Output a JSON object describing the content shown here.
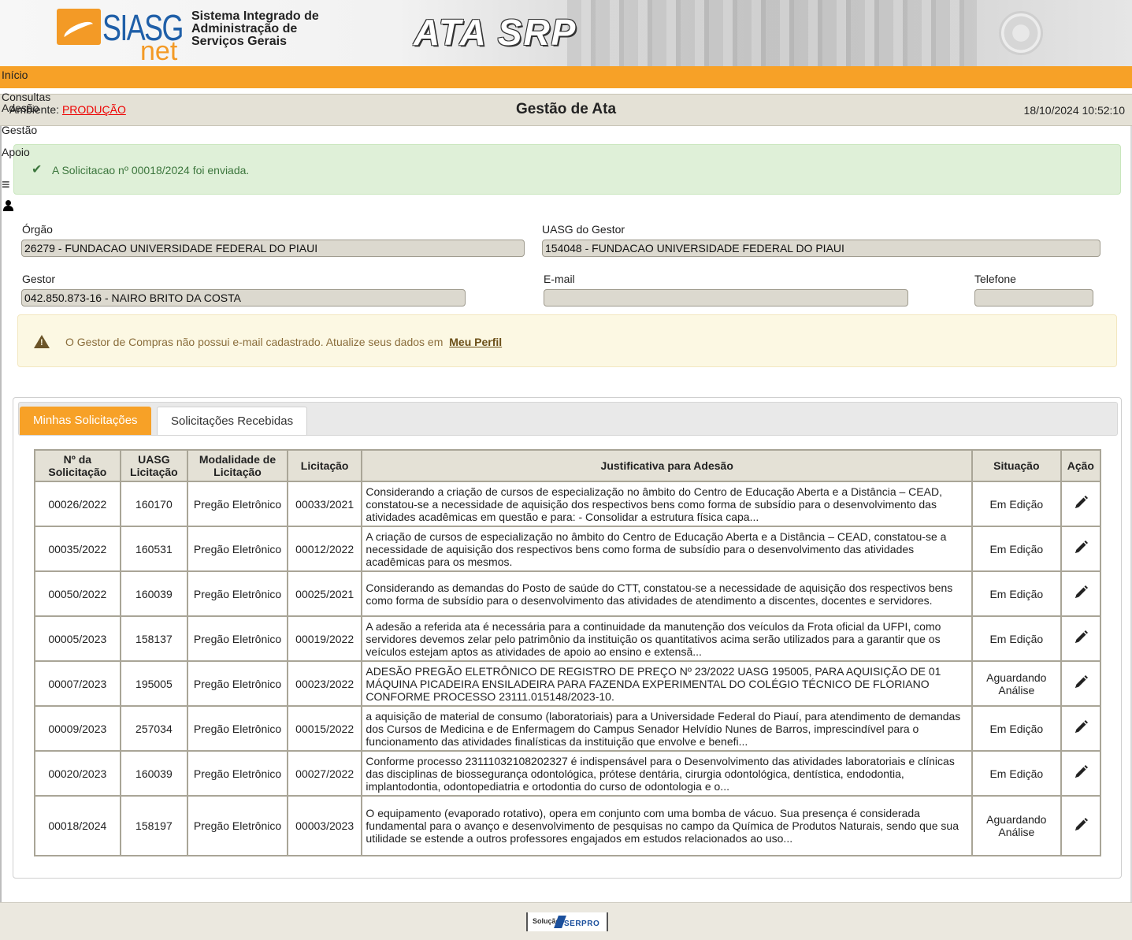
{
  "header": {
    "logo_siasg": "SIASG",
    "logo_net": "net",
    "system_name": "Sistema Integrado de Administração de Serviços Gerais",
    "app_title": "ATA SRP"
  },
  "nav": [
    "Início",
    "Consultas",
    "Adesão",
    "Gestão",
    "Apoio"
  ],
  "titlebar": {
    "ambiente_label": "Ambiente:",
    "ambiente_value": "PRODUÇÃO",
    "page_title": "Gestão de Ata",
    "datetime": "18/10/2024 10:52:10"
  },
  "success_alert": "A Solicitacao nº 00018/2024 foi enviada.",
  "form": {
    "orgao_label": "Órgão",
    "orgao_value": "26279 - FUNDACAO UNIVERSIDADE FEDERAL DO PIAUI",
    "uasg_gestor_label": "UASG do Gestor",
    "uasg_gestor_value": "154048 - FUNDACAO UNIVERSIDADE FEDERAL DO PIAUI",
    "gestor_label": "Gestor",
    "gestor_value": "042.850.873-16 - NAIRO BRITO DA COSTA",
    "email_label": "E-mail",
    "email_value": "",
    "telefone_label": "Telefone",
    "telefone_value": ""
  },
  "warning": {
    "text": "O Gestor de Compras não possui e-mail cadastrado. Atualize seus dados em",
    "link": "Meu Perfil"
  },
  "tabs": [
    "Minhas Solicitações",
    "Solicitações Recebidas"
  ],
  "table": {
    "headers": [
      "Nº da Solicitação",
      "UASG Licitação",
      "Modalidade de Licitação",
      "Licitação",
      "Justificativa para Adesão",
      "Situação",
      "Ação"
    ],
    "rows": [
      [
        "00026/2022",
        "160170",
        "Pregão Eletrônico",
        "00033/2021",
        "Considerando a criação de cursos de especialização no âmbito do Centro de Educação Aberta e a Distância – CEAD, constatou-se a necessidade de aquisição dos respectivos bens como forma de subsídio para o desenvolvimento das atividades acadêmicas em questão e para: - Consolidar a estrutura física capa...",
        "Em Edição"
      ],
      [
        "00035/2022",
        "160531",
        "Pregão Eletrônico",
        "00012/2022",
        "A criação de cursos de especialização no âmbito do Centro de Educação Aberta e a Distância – CEAD, constatou-se a necessidade de aquisição dos respectivos bens como forma de subsídio para o desenvolvimento das atividades acadêmicas para os mesmos.",
        "Em Edição"
      ],
      [
        "00050/2022",
        "160039",
        "Pregão Eletrônico",
        "00025/2021",
        "Considerando as demandas do Posto de saúde do CTT, constatou-se a necessidade de aquisição dos respectivos bens como forma de subsídio para o desenvolvimento das atividades de atendimento a discentes, docentes e servidores.",
        "Em Edição"
      ],
      [
        "00005/2023",
        "158137",
        "Pregão Eletrônico",
        "00019/2022",
        "A adesão a referida ata é necessária para a continuidade da manutenção dos veículos da Frota oficial da UFPI, como servidores devemos zelar pelo patrimônio da instituição os quantitativos acima serão utilizados para a garantir que os veículos estejam aptos as atividades de apoio ao ensino e extensã...",
        "Em Edição"
      ],
      [
        "00007/2023",
        "195005",
        "Pregão Eletrônico",
        "00023/2022",
        "ADESÃO PREGÃO ELETRÔNICO DE REGISTRO DE PREÇO Nº 23/2022 UASG 195005, PARA AQUISIÇÃO DE 01 MÁQUINA PICADEIRA ENSILADEIRA PARA FAZENDA EXPERIMENTAL DO COLÉGIO TÉCNICO DE FLORIANO CONFORME PROCESSO 23111.015148/2023-10.",
        "Aguardando Análise"
      ],
      [
        "00009/2023",
        "257034",
        "Pregão Eletrônico",
        "00015/2022",
        "a aquisição de material de consumo (laboratoriais) para a Universidade Federal do Piauí, para atendimento de demandas dos Cursos de Medicina e de Enfermagem do Campus Senador Helvídio Nunes de Barros, imprescindível para o funcionamento das atividades finalísticas da instituição que envolve e benefi...",
        "Em Edição"
      ],
      [
        "00020/2023",
        "160039",
        "Pregão Eletrônico",
        "00027/2022",
        "Conforme processo 23111032108202327 é indispensável para o Desenvolvimento das atividades laboratoriais e clínicas das disciplinas de biossegurança odontológica, prótese dentária, cirurgia odontológica, dentística, endodontia, implantodontia, odontopediatria e ortodontia do curso de odontologia e o...",
        "Em Edição"
      ],
      [
        "00018/2024",
        "158197",
        "Pregão Eletrônico",
        "00003/2023",
        "O equipamento (evaporado rotativo), opera em conjunto com uma bomba de vácuo. Sua presença é considerada fundamental para o avanço e desenvolvimento de pesquisas no campo da Química de Produtos Naturais, sendo que sua utilidade se estende a outros professores engajados em estudos relacionados ao uso...",
        "Aguardando Análise"
      ]
    ]
  },
  "footer": {
    "solucao": "Solução",
    "serpro": "SERPRO"
  }
}
